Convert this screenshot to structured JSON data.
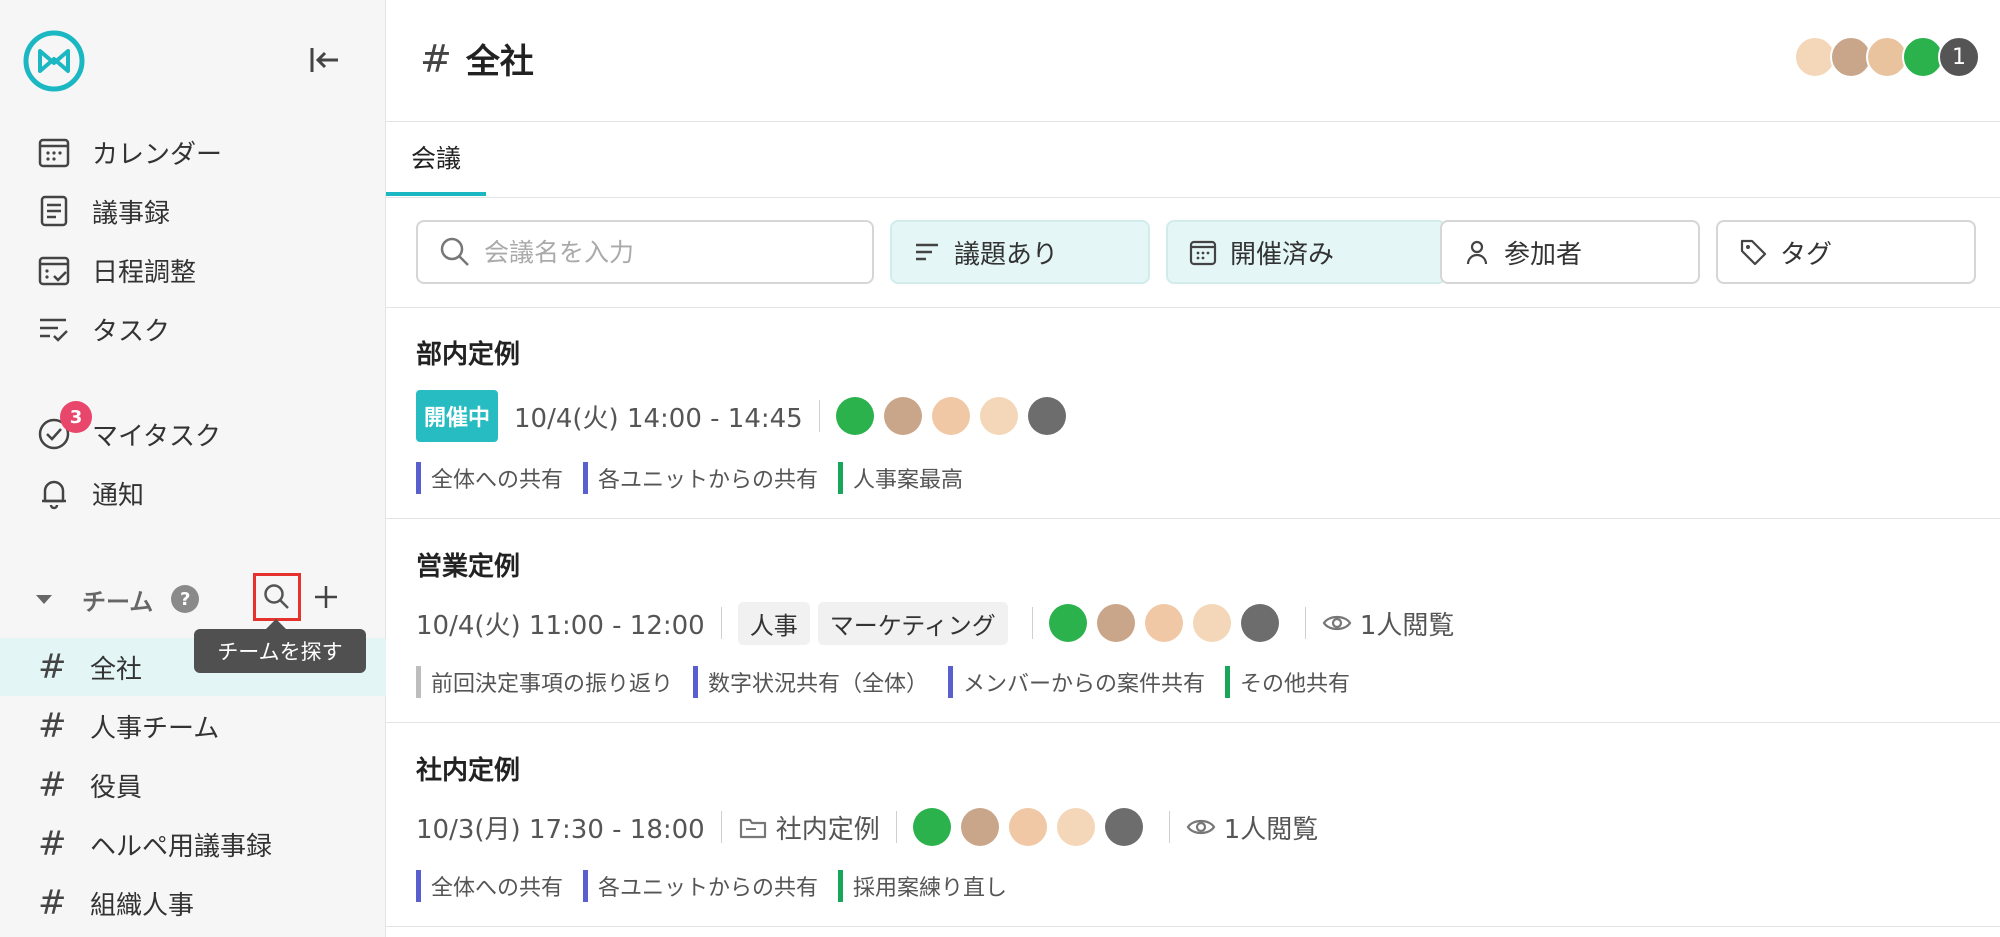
{
  "sidebar": {
    "nav": [
      {
        "label": "カレンダー",
        "icon": "calendar-icon"
      },
      {
        "label": "議事録",
        "icon": "document-icon"
      },
      {
        "label": "日程調整",
        "icon": "schedule-icon"
      },
      {
        "label": "タスク",
        "icon": "tasklist-icon"
      }
    ],
    "mytask": {
      "label": "マイタスク",
      "badge": "3"
    },
    "notify": {
      "label": "通知"
    },
    "team_header": {
      "label": "チーム",
      "help": "?"
    },
    "tooltip": "チームを探す",
    "teams": [
      "全社",
      "人事チーム",
      "役員",
      "ヘルペ用議事録",
      "組織人事"
    ]
  },
  "header": {
    "title": "全社",
    "member_count": "1"
  },
  "tabs": [
    {
      "label": "会議"
    }
  ],
  "filters": {
    "search_placeholder": "会議名を入力",
    "agenda": "議題あり",
    "held": "開催済み",
    "participants": "参加者",
    "tags": "タグ"
  },
  "meetings": [
    {
      "title": "部内定例",
      "status": "開催中",
      "time": "10/4(火) 14:00 - 14:45",
      "agenda": [
        {
          "label": "全体への共有",
          "color": "#5a5fcf"
        },
        {
          "label": "各ユニットからの共有",
          "color": "#5a5fcf"
        },
        {
          "label": "人事案最高",
          "color": "#1aa65a"
        }
      ]
    },
    {
      "title": "営業定例",
      "time": "10/4(火) 11:00 - 12:00",
      "tags": [
        "人事",
        "マーケティング"
      ],
      "views": "1人閲覧",
      "agenda": [
        {
          "label": "前回決定事項の振り返り",
          "color": "#bdbdbd"
        },
        {
          "label": "数字状況共有（全体）",
          "color": "#5a5fcf"
        },
        {
          "label": "メンバーからの案件共有",
          "color": "#5a5fcf"
        },
        {
          "label": "その他共有",
          "color": "#1aa65a"
        }
      ]
    },
    {
      "title": "社内定例",
      "time": "10/3(月) 17:30 - 18:00",
      "folder": "社内定例",
      "views": "1人閲覧",
      "agenda": [
        {
          "label": "全体への共有",
          "color": "#5a5fcf"
        },
        {
          "label": "各ユニットからの共有",
          "color": "#5a5fcf"
        },
        {
          "label": "採用案練り直し",
          "color": "#1aa65a"
        }
      ]
    }
  ],
  "colors": {
    "accent": "#1bb8c4",
    "badge": "#e9466b",
    "live": "#27bcc2"
  }
}
